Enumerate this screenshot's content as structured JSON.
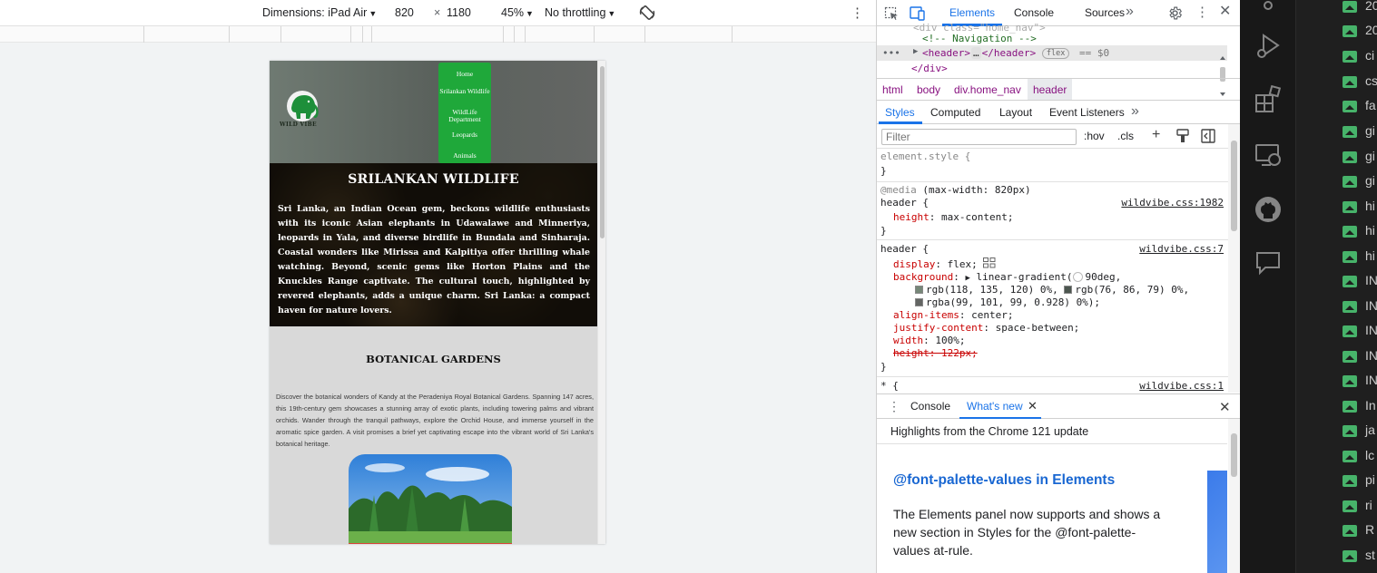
{
  "device_toolbar": {
    "dimensions_label": "Dimensions: iPad Air",
    "width": "820",
    "times": "×",
    "height": "1180",
    "zoom": "45%",
    "throttling": "No throttling"
  },
  "site": {
    "logo_text": "WILD VIBE",
    "nav": [
      "Home",
      "Srilankan Wildlife",
      "WildLife Department",
      "Leopards",
      "Animals"
    ],
    "hero_title": "SRILANKAN WILDLIFE",
    "hero_text": "Sri Lanka, an Indian Ocean gem, beckons wildlife enthusiasts with its iconic Asian elephants in Udawalawe and Minneriya, leopards in Yala, and diverse birdlife in Bundala and Sinharaja. Coastal wonders like Mirissa and Kalpitiya offer thrilling whale watching. Beyond, scenic gems like Horton Plains and the Knuckles Range captivate. The cultural touch, highlighted by revered elephants, adds a unique charm. Sri Lanka: a compact haven for nature lovers.",
    "botanical_title": "BOTANICAL GARDENS",
    "botanical_text": "Discover the botanical wonders of Kandy at the Peradeniya Royal Botanical Gardens. Spanning 147 acres, this 19th-century gem showcases a stunning array of exotic plants, including towering palms and vibrant orchids. Wander through the tranquil pathways, explore the Orchid House, and immerse yourself in the aromatic spice garden. A visit promises a brief yet captivating escape into the vibrant world of Sri Lanka's botanical heritage."
  },
  "devtools": {
    "tabs": [
      "Elements",
      "Console",
      "Sources"
    ],
    "more_tabs": "»",
    "dom": {
      "line_comment": "<!-- Navigation -->",
      "line_header_open": "<header>",
      "line_header_ellipsis": "…",
      "line_header_close": "</header>",
      "flex_badge": "flex",
      "eq_ref": "== $0",
      "line_div_close": "</div>",
      "line_top_partial": "<div class=\"home_nav\">"
    },
    "breadcrumbs": [
      "html",
      "body",
      "div.home_nav",
      "header"
    ],
    "styles_tabs": [
      "Styles",
      "Computed",
      "Layout",
      "Event Listeners"
    ],
    "filter_placeholder": "Filter",
    "hov": ":hov",
    "cls": ".cls",
    "rules": {
      "element_style": "element.style {",
      "close": "}",
      "media": "@media",
      "media_query": "(max-width: 820px)",
      "header_sel": "header {",
      "src1": "wildvibe.css:1982",
      "height_prop": "height",
      "height_val": "max-content;",
      "src2": "wildvibe.css:7",
      "display_prop": "display",
      "display_val": "flex;",
      "background_prop": "background",
      "background_val": "linear-gradient(",
      "deg_val": "90deg,",
      "stop1": "rgb(118, 135, 120) 0%,",
      "stop2": "rgb(76, 86, 79) 0%,",
      "stop3": "rgba(99, 101, 99, 0.928) 0%);",
      "align_prop": "align-items",
      "align_val": "center;",
      "justify_prop": "justify-content",
      "justify_val": "space-between;",
      "width_prop": "width",
      "width_val": "100%;",
      "height_struck": "height: 122px;",
      "star_sel": "* {",
      "src3": "wildvibe.css:1"
    },
    "drawer": {
      "tabs": [
        "Console",
        "What's new"
      ],
      "highlights": "Highlights from the Chrome 121 update",
      "heading": "@font-palette-values in Elements",
      "body": "The Elements panel now supports and shows a new section in Styles for the @font-palette-values at-rule."
    },
    "colors": {
      "accent": "#1a73e8",
      "tag": "#881280",
      "property": "#c80000"
    }
  },
  "vscode": {
    "files": [
      "20",
      "20",
      "ci",
      "cs",
      "fa",
      "gi",
      "gi",
      "gi",
      "hi",
      "hi",
      "hi",
      "IN",
      "IN",
      "IN",
      "IN",
      "IN",
      "In",
      "ja",
      "lc",
      "pi",
      "ri",
      "R",
      "st"
    ],
    "activity_icons": [
      "source-control-icon",
      "run-debug-icon",
      "extensions-icon",
      "remote-explorer-icon",
      "github-icon",
      "live-share-icon"
    ]
  }
}
